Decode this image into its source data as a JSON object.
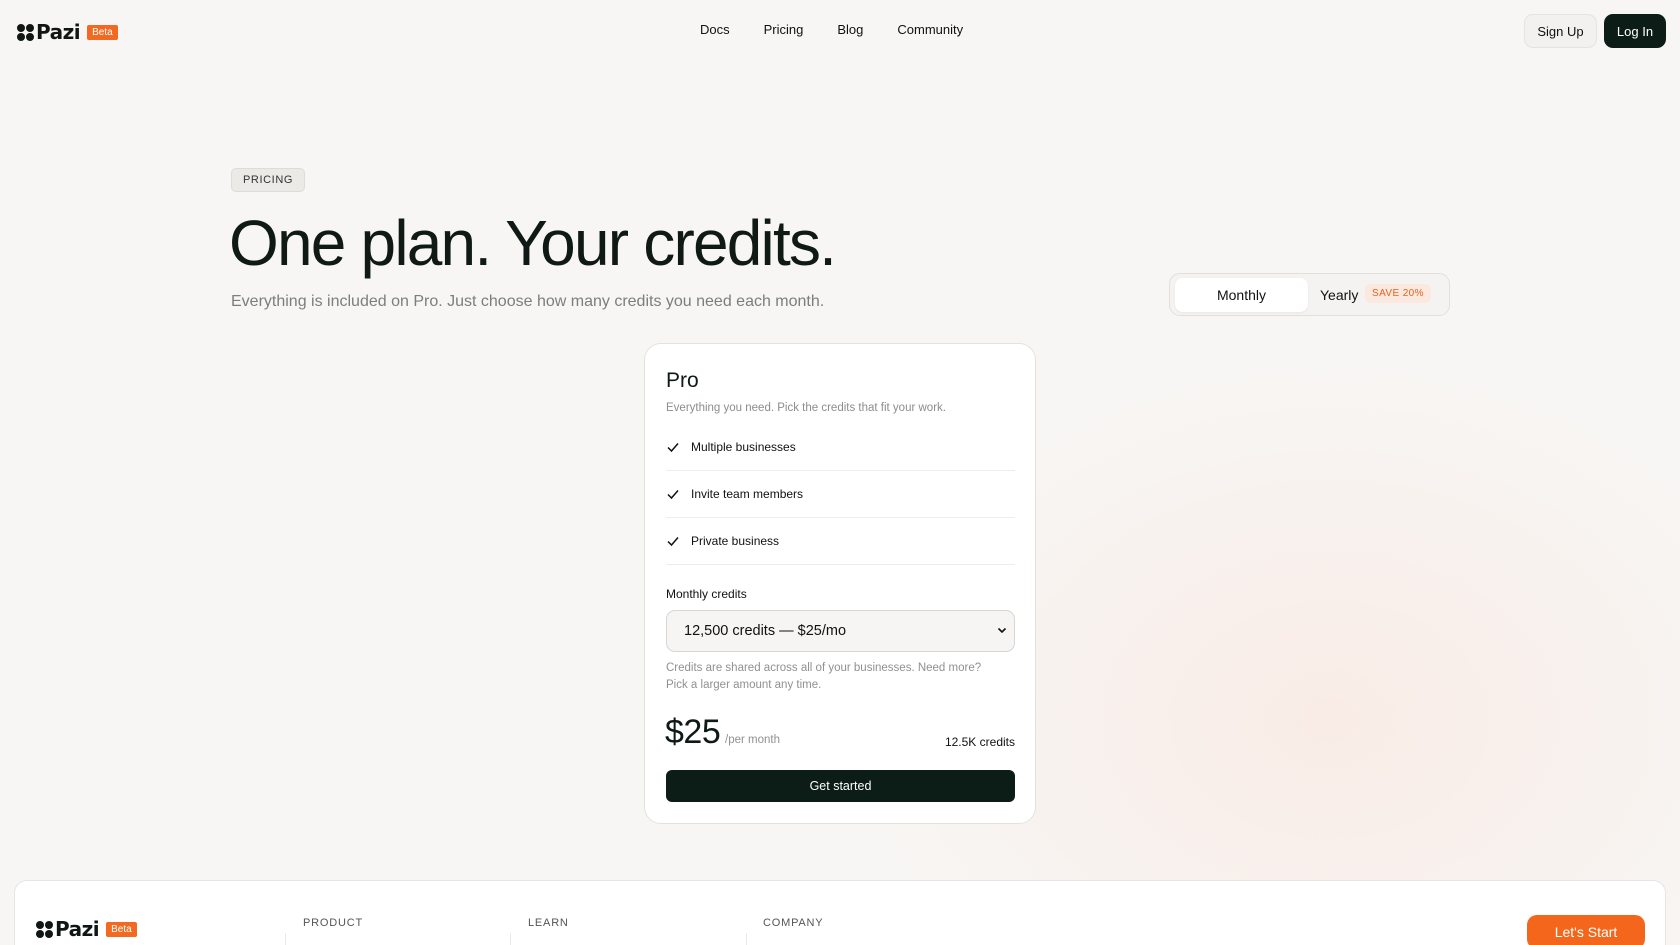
{
  "brand": {
    "name": "Pazi",
    "badge": "Beta"
  },
  "nav": {
    "items": [
      "Docs",
      "Pricing",
      "Blog",
      "Community"
    ]
  },
  "auth": {
    "signup": "Sign Up",
    "login": "Log In"
  },
  "hero": {
    "eyebrow": "PRICING",
    "title": "One plan. Your credits.",
    "subtitle": "Everything is included on Pro. Just choose how many credits you need each month."
  },
  "billing_toggle": {
    "monthly": "Monthly",
    "yearly": "Yearly",
    "save": "SAVE 20%",
    "selected": "Monthly"
  },
  "plan": {
    "name": "Pro",
    "description": "Everything you need. Pick the credits that fit your work.",
    "features": [
      "Multiple businesses",
      "Invite team members",
      "Private business"
    ],
    "credits_label": "Monthly credits",
    "credits_selected": "12,500 credits — $25/mo",
    "credits_note": "Credits are shared across all of your businesses. Need more? Pick a larger amount any time.",
    "price": "$25",
    "per": "/per month",
    "credit_count": "12.5K credits",
    "cta": "Get started"
  },
  "footer": {
    "columns": [
      "PRODUCT",
      "LEARN",
      "COMPANY"
    ],
    "cta": "Let's Start"
  }
}
